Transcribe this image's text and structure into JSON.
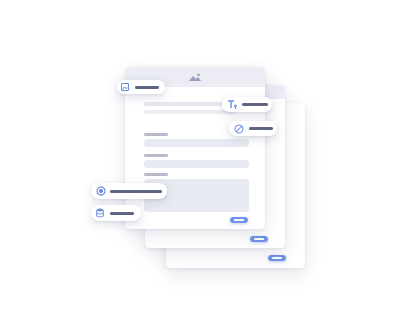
{
  "icons": {
    "header": "image-icon",
    "chip_image": "image-icon",
    "chip_text": "text-format-icon",
    "chip_blocked": "blocked-icon",
    "chip_radio": "radio-button-icon",
    "chip_database": "database-icon"
  },
  "colors": {
    "accent": "#6f93e8",
    "icon": "#6a8de0",
    "placeholder_dark": "#5f6480",
    "placeholder_light": "#e8eaf2",
    "header": "#ebecf4"
  }
}
